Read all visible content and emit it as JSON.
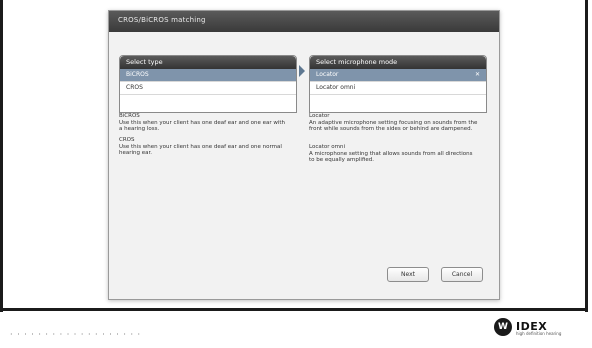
{
  "window": {
    "title": "CROS/BiCROS matching"
  },
  "type_panel": {
    "header": "Select type",
    "options": [
      {
        "label": "BiCROS",
        "selected": true
      },
      {
        "label": "CROS",
        "selected": false
      }
    ]
  },
  "mic_panel": {
    "header": "Select microphone mode",
    "options": [
      {
        "label": "Locator",
        "selected": true
      },
      {
        "label": "Locator omni",
        "selected": false
      }
    ],
    "selected_icon": "checkmark-icon"
  },
  "descriptions": {
    "bicros": {
      "title": "BiCROS",
      "text": "Use this when your client has one deaf ear and one ear with a hearing loss."
    },
    "cros": {
      "title": "CROS",
      "text": "Use this when your client has one deaf ear and one normal hearing ear."
    },
    "locator": {
      "title": "Locator",
      "text": "An adaptive microphone setting focusing on sounds from the front while sounds from the sides or behind are dampened."
    },
    "locator_omni": {
      "title": "Locator omni",
      "text": "A microphone setting that allows sounds from all directions to be equally amplified."
    }
  },
  "buttons": {
    "next": "Next",
    "cancel": "Cancel"
  },
  "brand": {
    "badge": "W",
    "name": "IDEX",
    "tagline": "high definition hearing"
  },
  "colors": {
    "selected_row": "#7f94ab",
    "header_dark": "#3a3a3a"
  }
}
